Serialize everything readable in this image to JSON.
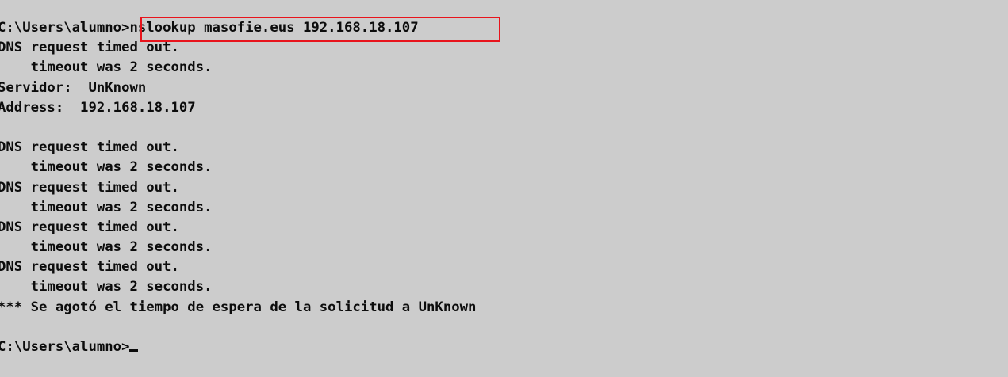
{
  "terminal": {
    "prompt_1": "C:\\Users\\alumno>",
    "command_1": "nslookup masofie.eus 192.168.18.107",
    "output_lines": [
      "DNS request timed out.",
      "    timeout was 2 seconds.",
      "Servidor:  UnKnown",
      "Address:  192.168.18.107",
      "",
      "DNS request timed out.",
      "    timeout was 2 seconds.",
      "DNS request timed out.",
      "    timeout was 2 seconds.",
      "DNS request timed out.",
      "    timeout was 2 seconds.",
      "DNS request timed out.",
      "    timeout was 2 seconds.",
      "*** Se agotó el tiempo de espera de la solicitud a UnKnown",
      ""
    ],
    "prompt_2": "C:\\Users\\alumno>",
    "highlight_color": "#e8141c",
    "background_color": "#cccccc",
    "text_color": "#0c0c0c"
  }
}
